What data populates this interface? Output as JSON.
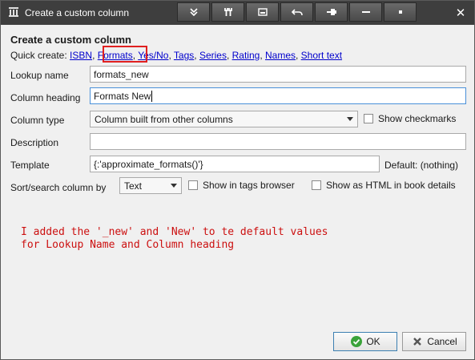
{
  "window": {
    "title": "Create a custom column"
  },
  "toolbar": {
    "buttons": [
      {
        "icon": "move-down-icon"
      },
      {
        "icon": "wrench-icon"
      },
      {
        "icon": "minimize-to-tray-icon"
      },
      {
        "icon": "undo-icon"
      },
      {
        "icon": "pin-icon"
      },
      {
        "icon": "minimize-icon"
      },
      {
        "icon": "dot-icon"
      }
    ]
  },
  "form": {
    "heading": "Create a custom column",
    "quick_create_label": "Quick create:",
    "quick_links": [
      "ISBN",
      "Formats",
      "Yes/No",
      "Tags",
      "Series",
      "Rating",
      "Names",
      "Short text"
    ],
    "lookup_name": {
      "label": "Lookup name",
      "value": "formats_new"
    },
    "column_heading": {
      "label": "Column heading",
      "value": "Formats New"
    },
    "column_type": {
      "label": "Column type",
      "value": "Column built from other columns",
      "show_checkmarks": "Show checkmarks"
    },
    "description": {
      "label": "Description",
      "value": ""
    },
    "template": {
      "label": "Template",
      "value": "{:'approximate_formats()'}",
      "default_label": "Default: (nothing)"
    },
    "sort_search": {
      "label": "Sort/search column by",
      "value": "Text",
      "tags_browser": "Show in tags browser",
      "html_details": "Show as HTML in book details"
    }
  },
  "annotation": {
    "line1": "I added the '_new' and 'New' to te default values",
    "line2": "for Lookup Name and Column heading",
    "color": "#cc1010"
  },
  "buttons": {
    "ok": "OK",
    "cancel": "Cancel"
  }
}
